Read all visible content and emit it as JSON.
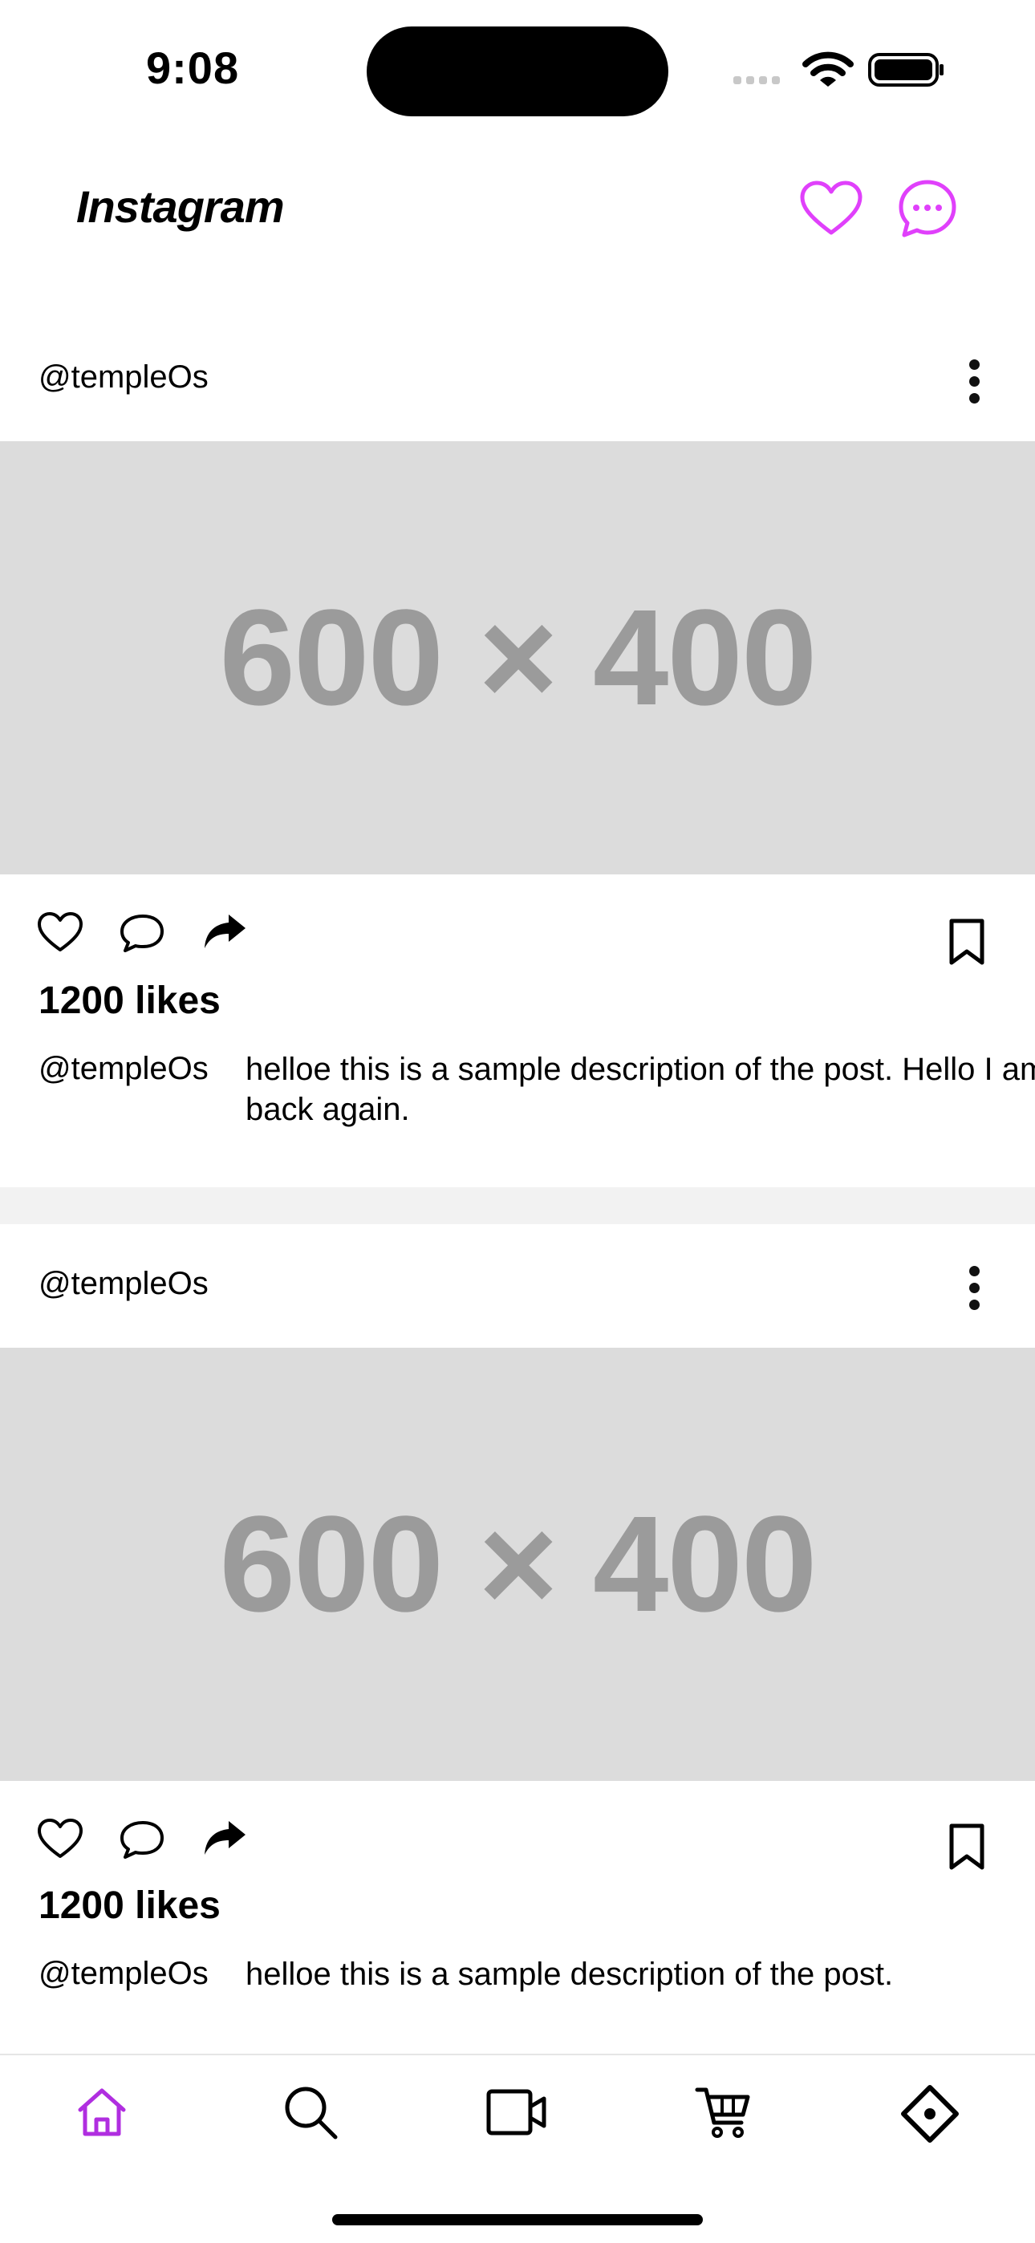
{
  "status_bar": {
    "time": "9:08"
  },
  "header": {
    "title": "Instagram",
    "accent_color": "#e040fb"
  },
  "posts": [
    {
      "username": "@templeOs",
      "image_text": "600 × 400",
      "likes": "1200 likes",
      "caption_user": "@templeOs",
      "caption_text": "helloe this is a sample description of the post. Hello I am back again."
    },
    {
      "username": "@templeOs",
      "image_text": "600 × 400",
      "likes": "1200 likes",
      "caption_user": "@templeOs",
      "caption_text": "helloe this is a sample description of the post."
    }
  ],
  "bottom_nav": {
    "items": [
      {
        "icon": "home-icon",
        "active": true
      },
      {
        "icon": "search-icon",
        "active": false
      },
      {
        "icon": "video-icon",
        "active": false
      },
      {
        "icon": "cart-icon",
        "active": false
      },
      {
        "icon": "directions-icon",
        "active": false
      }
    ],
    "active_color": "#b02ee0"
  }
}
